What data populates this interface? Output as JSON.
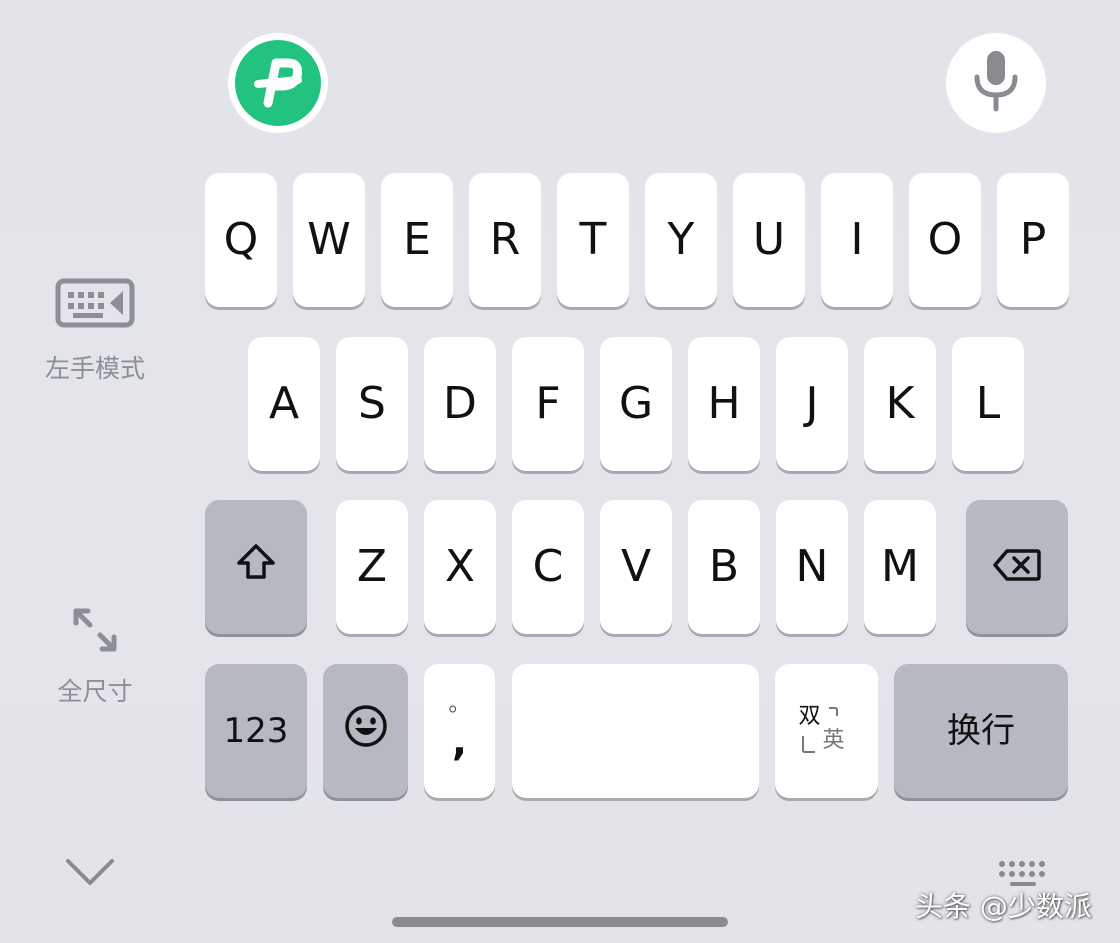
{
  "toolbar": {
    "logo_icon": "p-logo-icon",
    "logo_color": "#22c37f",
    "mic_icon": "microphone-icon"
  },
  "keyboard": {
    "row1": [
      "Q",
      "W",
      "E",
      "R",
      "T",
      "Y",
      "U",
      "I",
      "O",
      "P"
    ],
    "row2": [
      "A",
      "S",
      "D",
      "F",
      "G",
      "H",
      "J",
      "K",
      "L"
    ],
    "row3": [
      "Z",
      "X",
      "C",
      "V",
      "B",
      "N",
      "M"
    ],
    "shift_icon": "shift-arrow-icon",
    "backspace_icon": "backspace-icon",
    "numbers_label": "123",
    "emoji_icon": "smiley-emoji-icon",
    "punct_top": "。",
    "punct_bottom": ",",
    "lang_top": "双",
    "lang_bottom": "英",
    "enter_label": "换行"
  },
  "side": {
    "left_hand_label": "左手模式",
    "left_hand_icon": "keyboard-left-icon",
    "full_size_label": "全尺寸",
    "full_size_icon": "expand-arrows-icon",
    "collapse_icon": "chevron-down-icon",
    "switch_keyboard_icon": "keyboard-grid-icon"
  },
  "watermark": "头条 @少数派",
  "colors": {
    "background": "#e4e5ea",
    "key": "#ffffff",
    "function_key": "#b6b9c1",
    "label_gray": "#8d8f96"
  }
}
